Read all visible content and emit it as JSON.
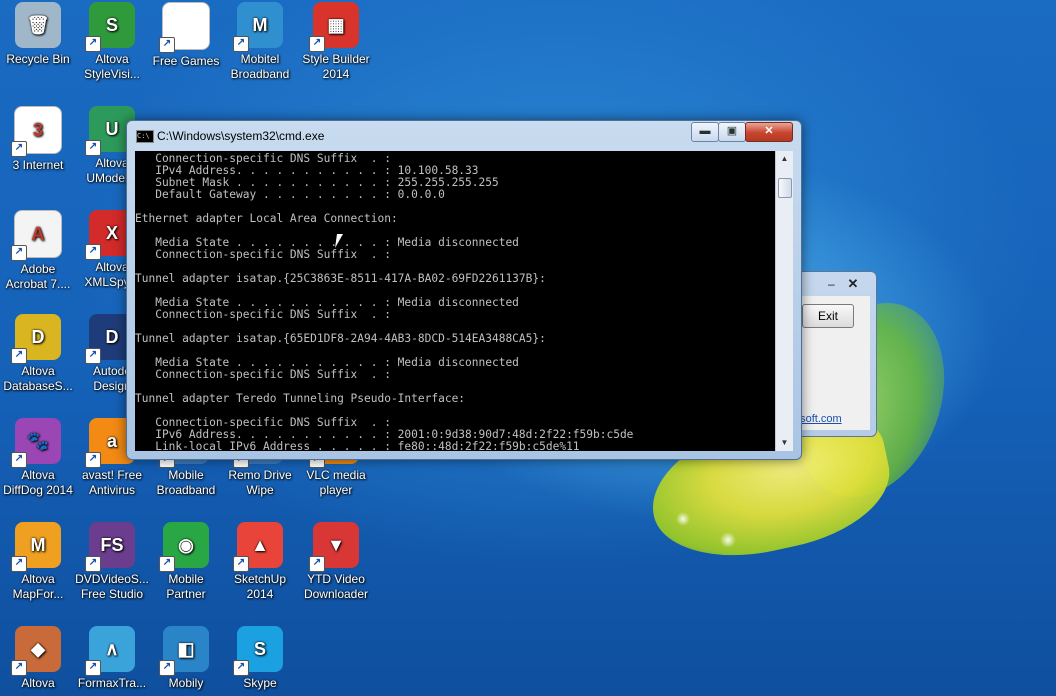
{
  "desktop_icons": [
    {
      "label": "Recycle Bin",
      "icon": "recycle-bin-icon",
      "color": "#9fb7c9",
      "glyph": "🗑"
    },
    {
      "label": "Altova StyleVisi...",
      "icon": "altova-stylevision-icon",
      "color": "#2e9a3c",
      "glyph": "S"
    },
    {
      "label": "Free Games",
      "icon": "document-icon",
      "color": "#ffffff",
      "glyph": ""
    },
    {
      "label": "Mobitel Broadband",
      "icon": "mobitel-icon",
      "color": "#2f8fcf",
      "glyph": "M"
    },
    {
      "label": "Style Builder 2014",
      "icon": "style-builder-icon",
      "color": "#d9342b",
      "glyph": "▦"
    },
    {
      "label": "3 Internet",
      "icon": "three-internet-icon",
      "color": "#ffffff",
      "glyph": "3"
    },
    {
      "label": "Altova UModel 2",
      "icon": "altova-umodel-icon",
      "color": "#2c9a5a",
      "glyph": "U"
    },
    {
      "label": "Adobe Acrobat 7....",
      "icon": "adobe-acrobat-icon",
      "color": "#f4f4f4",
      "glyph": "A"
    },
    {
      "label": "Altova XMLSpy 2",
      "icon": "altova-xmlspy-icon",
      "color": "#d32a2a",
      "glyph": "X"
    },
    {
      "label": "Altova DatabaseS...",
      "icon": "altova-databasespy-icon",
      "color": "#d9b521",
      "glyph": "D"
    },
    {
      "label": "Autode Design",
      "icon": "autodesk-design-icon",
      "color": "#1f3c7a",
      "glyph": "D"
    },
    {
      "label": "Altova DiffDog 2014",
      "icon": "altova-diffdog-icon",
      "color": "#9b46b5",
      "glyph": "🐾"
    },
    {
      "label": "avast! Free Antivirus",
      "icon": "avast-icon",
      "color": "#f28a14",
      "glyph": "a"
    },
    {
      "label": "Mobile Broadband",
      "icon": "mobile-broadband-icon",
      "color": "#3a7dbd",
      "glyph": ""
    },
    {
      "label": "Remo Drive Wipe",
      "icon": "remo-drive-wipe-icon",
      "color": "#3a7dbd",
      "glyph": ""
    },
    {
      "label": "VLC media player",
      "icon": "vlc-icon",
      "color": "#f08a10",
      "glyph": ""
    },
    {
      "label": "Altova MapFor...",
      "icon": "altova-mapforce-icon",
      "color": "#f0a020",
      "glyph": "M"
    },
    {
      "label": "DVDVideoS... Free Studio",
      "icon": "dvdvideosoft-icon",
      "color": "#6b3d8f",
      "glyph": "FS"
    },
    {
      "label": "Mobile Partner",
      "icon": "mobile-partner-icon",
      "color": "#29a745",
      "glyph": "◉"
    },
    {
      "label": "SketchUp 2014",
      "icon": "sketchup-icon",
      "color": "#e8443a",
      "glyph": "▲"
    },
    {
      "label": "YTD Video Downloader",
      "icon": "ytd-downloader-icon",
      "color": "#d93636",
      "glyph": "▼"
    },
    {
      "label": "Altova",
      "icon": "altova-icon",
      "color": "#c86a3a",
      "glyph": "◆"
    },
    {
      "label": "FormaxTra...",
      "icon": "formaxtra-icon",
      "color": "#3aa3d9",
      "glyph": "∧"
    },
    {
      "label": "Mobily",
      "icon": "mobily-icon",
      "color": "#2a84c8",
      "glyph": "◧"
    },
    {
      "label": "Skype",
      "icon": "skype-icon",
      "color": "#1ba0e1",
      "glyph": "S"
    }
  ],
  "cmd_window": {
    "title": "C:\\Windows\\system32\\cmd.exe",
    "icon_text": "C:\\",
    "min_label": "▬",
    "max_label": "▣",
    "close_label": "✕",
    "console_lines": [
      "   Connection-specific DNS Suffix  . :",
      "   IPv4 Address. . . . . . . . . . . : 10.100.58.33",
      "   Subnet Mask . . . . . . . . . . . : 255.255.255.255",
      "   Default Gateway . . . . . . . . . : 0.0.0.0",
      "",
      "Ethernet adapter Local Area Connection:",
      "",
      "   Media State . . . . . . . . . . . : Media disconnected",
      "   Connection-specific DNS Suffix  . :",
      "",
      "Tunnel adapter isatap.{25C3863E-8511-417A-BA02-69FD2261137B}:",
      "",
      "   Media State . . . . . . . . . . . : Media disconnected",
      "   Connection-specific DNS Suffix  . :",
      "",
      "Tunnel adapter isatap.{65ED1DF8-2A94-4AB3-8DCD-514EA3488CA5}:",
      "",
      "   Media State . . . . . . . . . . . : Media disconnected",
      "   Connection-specific DNS Suffix  . :",
      "",
      "Tunnel adapter Teredo Tunneling Pseudo-Interface:",
      "",
      "   Connection-specific DNS Suffix  . :",
      "   IPv6 Address. . . . . . . . . . . : 2001:0:9d38:90d7:48d:2f22:f59b:c5de",
      "   Link-local IPv6 Address . . . . . : fe80::48d:2f22:f59b:c5de%11"
    ],
    "scroll_up": "▲",
    "scroll_down": "▼"
  },
  "background_dialog": {
    "minimize_label": "–",
    "close_label": "✕",
    "exit_label": "Exit",
    "link_text": "osoft.com"
  }
}
